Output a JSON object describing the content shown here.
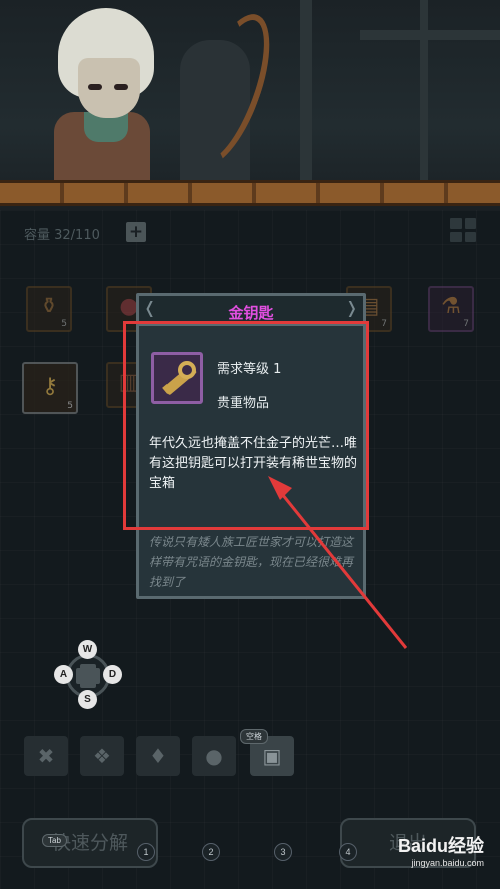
{
  "inventory": {
    "capacity_label": "容量 32/110",
    "add_icon": "plus-icon"
  },
  "slots": [
    {
      "icon": "urn-icon",
      "count": "5",
      "rarity": "common"
    },
    {
      "icon": "potion-icon",
      "count": "",
      "rarity": "common"
    },
    {
      "icon": "scroll-icon",
      "count": "7",
      "rarity": "common"
    },
    {
      "icon": "potion-icon",
      "count": "7",
      "rarity": "epic"
    },
    {
      "icon": "gold-key-icon",
      "count": "5",
      "rarity": "common"
    },
    {
      "icon": "book-icon",
      "count": "",
      "rarity": "common"
    }
  ],
  "tooltip": {
    "name": "金钥匙",
    "requirement": "需求等级 1",
    "category": "贵重物品",
    "description": "年代久远也掩盖不住金子的光芒…唯有这把钥匙可以打开装有稀世宝物的宝箱",
    "lore": "传说只有矮人族工匠世家才可以打造这样带有咒语的金钥匙，现在已经很难再找到了"
  },
  "dpad": {
    "up": "W",
    "left": "A",
    "right": "D",
    "down": "S"
  },
  "filters": {
    "tab_icons": [
      "tools-icon",
      "paw-icon",
      "gem-icon",
      "material-icon",
      "chest-icon"
    ],
    "active_hint": "空格"
  },
  "bottom": {
    "decompose_label": "快速分解",
    "decompose_hint": "Tab",
    "exit_label": "退出",
    "number_hints": [
      "1",
      "2",
      "3",
      "4"
    ]
  },
  "watermark": {
    "logo": "Baidu经验",
    "url": "jingyan.baidu.com"
  },
  "colors": {
    "tooltip_title": "#e24fe0",
    "highlight": "#e23a3a",
    "epic_border": "#8e5ea4"
  }
}
